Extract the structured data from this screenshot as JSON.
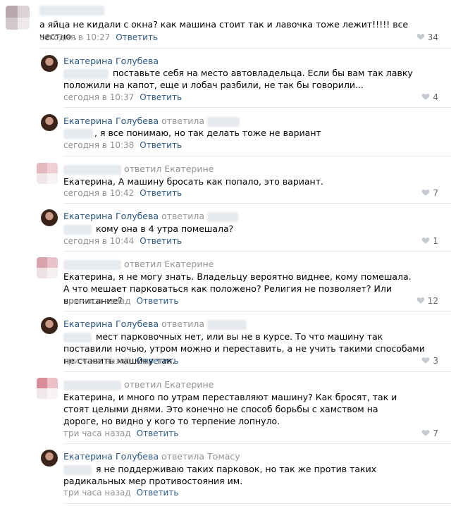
{
  "comments": [
    {
      "author": "",
      "text": "а яйца не кидали с окна? как машина стоит так и лавочка тоже лежит!!!!! все честно .",
      "time": "сегодня в 10:27",
      "reply": "Ответить",
      "likes": "34"
    },
    {
      "author": "Екатерина Голубева",
      "text": "поставьте себя на место автовладельца. Если бы вам так лавку положили на капот, еще и лобач разбили, не так бы говорили...",
      "time": "сегодня в 10:37",
      "reply": "Ответить",
      "likes": "4"
    },
    {
      "author": "Екатерина Голубева",
      "replied": "ответила",
      "text": ", я все понимаю, но так делать тоже не вариант",
      "time": "сегодня в 10:38",
      "reply": "Ответить",
      "likes": ""
    },
    {
      "author": "",
      "replied": "ответил Екатерине",
      "text": "Екатерина, А машину бросать как попало, это вариант.",
      "time": "сегодня в 10:42",
      "reply": "Ответить",
      "likes": "7"
    },
    {
      "author": "Екатерина Голубева",
      "replied": "ответила",
      "text": "кому она в 4 утра помешала?",
      "time": "сегодня в 10:44",
      "reply": "Ответить",
      "likes": "1"
    },
    {
      "author": "",
      "replied": "ответил Екатерине",
      "text": "Екатерина, я не могу знать. Владельцу вероятно виднее, кому помешала. А что мешает парковаться как положено? Религия не позволяет? Или воспитание?",
      "time": "три часа назад",
      "reply": "Ответить",
      "likes": "12"
    },
    {
      "author": "Екатерина Голубева",
      "replied": "ответила",
      "text": "мест парковочных нет, или вы не в курсе. То что машину так поставили ночью, утром можно и переставить, а не учить такими способами не ставить машину так.",
      "time": "три часа назад",
      "reply": "Ответить",
      "likes": "3"
    },
    {
      "author": "",
      "replied": "ответил Екатерине",
      "text": "Екатерина, и много по утрам переставляют машину? Как бросят, так и стоят целыми днями. Это конечно не способ борьбы с хамством на дороге, но видно у кого то терпение лопнуло.",
      "time": "три часа назад",
      "reply": "Ответить",
      "likes": "7"
    },
    {
      "author": "Екатерина Голубева",
      "replied": "ответила Томасу",
      "text": "я не поддерживаю таких парковок, но так же против таких радикальных мер противостояния им.",
      "time": "три часа назад",
      "reply": "Ответить",
      "likes": ""
    }
  ],
  "colors": {
    "link": "#2a5885",
    "muted": "#939393",
    "divider": "#e7e8ec",
    "heart": "#c5c9d0"
  },
  "icons": {
    "like": "heart-icon",
    "avatar": "user-photo"
  }
}
